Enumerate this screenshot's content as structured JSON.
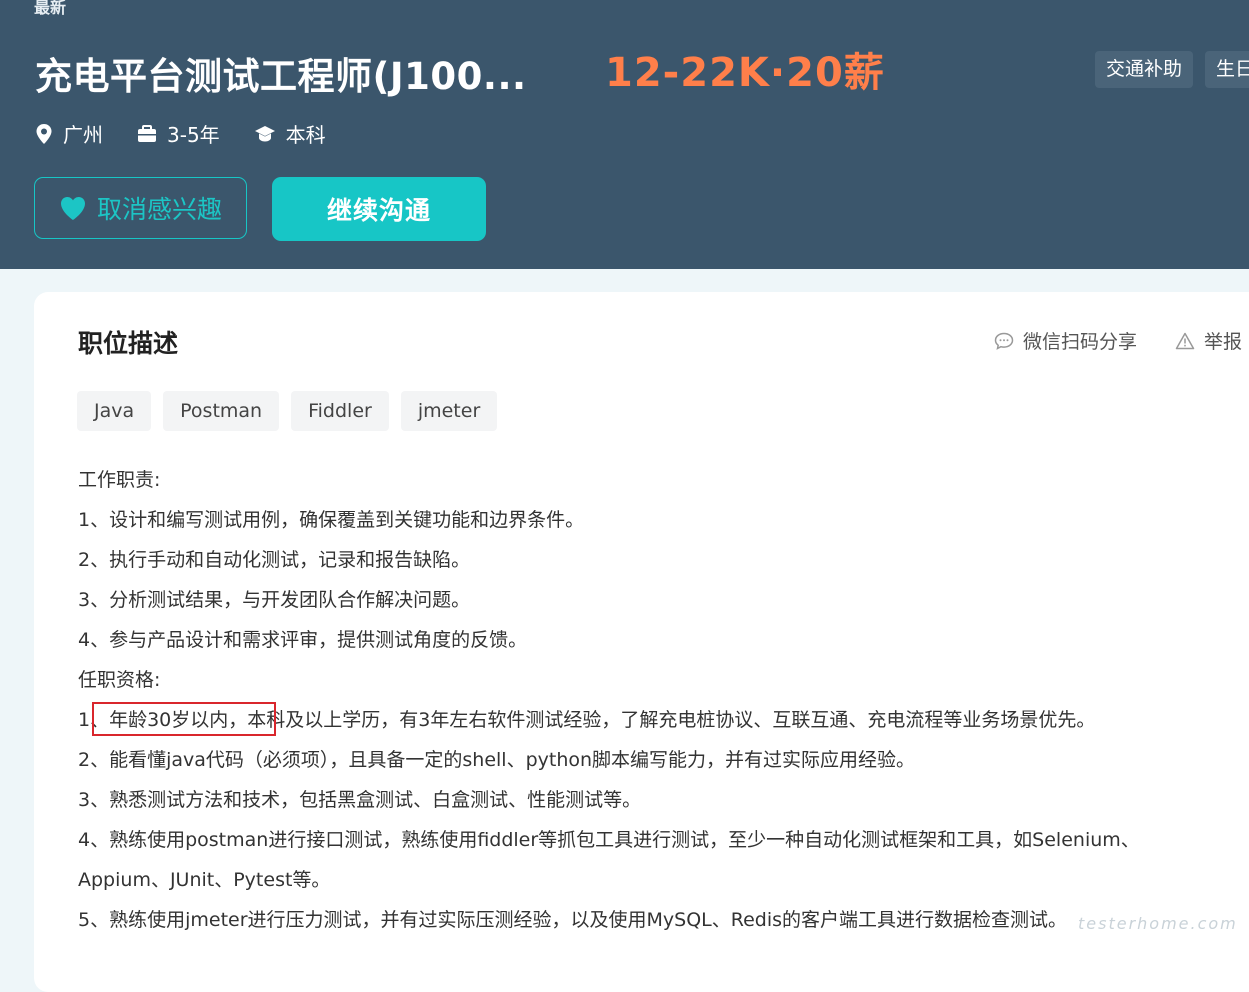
{
  "header": {
    "status": "最新",
    "job_title": "充电平台测试工程师(J100...",
    "salary": "12-22K·20薪",
    "benefits": [
      "交通补助",
      "生日"
    ],
    "meta": {
      "city": "广州",
      "experience": "3-5年",
      "education": "本科"
    },
    "buttons": {
      "interest": "取消感兴趣",
      "chat": "继续沟通"
    }
  },
  "description": {
    "title": "职位描述",
    "actions": {
      "share": "微信扫码分享",
      "report": "举报"
    },
    "skills": [
      "Java",
      "Postman",
      "Fiddler",
      "jmeter"
    ],
    "lines": [
      "工作职责:",
      "1、设计和编写测试用例，确保覆盖到关键功能和边界条件。",
      "2、执行手动和自动化测试，记录和报告缺陷。",
      "3、分析测试结果，与开发团队合作解决问题。",
      "4、参与产品设计和需求评审，提供测试角度的反馈。",
      "任职资格:",
      "1、年龄30岁以内，本科及以上学历，有3年左右软件测试经验，了解充电桩协议、互联互通、充电流程等业务场景优先。",
      "2、能看懂java代码（必须项），且具备一定的shell、python脚本编写能力，并有过实际应用经验。",
      "3、熟悉测试方法和技术，包括黑盒测试、白盒测试、性能测试等。",
      "4、熟练使用postman进行接口测试，熟练使用fiddler等抓包工具进行测试，至少一种自动化测试框架和工具，如Selenium、",
      "Appium、JUnit、Pytest等。",
      "5、熟练使用jmeter进行压力测试，并有过实际压测经验，以及使用MySQL、Redis的客户端工具进行数据检查测试。"
    ]
  },
  "watermark": "testerhome.com",
  "colors": {
    "header_bg": "#3b566c",
    "accent": "#17c6c6",
    "salary": "#ff7f4a",
    "highlight_border": "#d9262c"
  }
}
